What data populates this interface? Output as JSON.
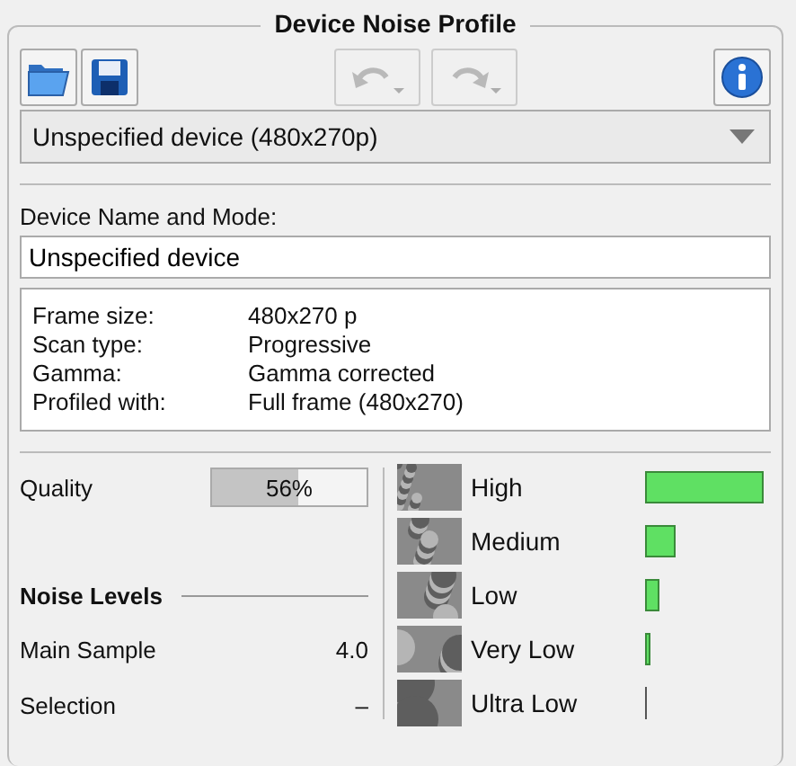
{
  "panel": {
    "title": "Device Noise Profile"
  },
  "toolbar": [
    {
      "kind": "open",
      "disabled": false
    },
    {
      "kind": "save",
      "disabled": false
    },
    {
      "kind": "undo",
      "disabled": true
    },
    {
      "kind": "redo",
      "disabled": true
    },
    {
      "kind": "info",
      "disabled": false
    }
  ],
  "device_dropdown": {
    "value": "Unspecified device (480x270p)"
  },
  "device_name": {
    "label": "Device Name and Mode:",
    "value": "Unspecified device"
  },
  "details": [
    {
      "label": "Frame size:",
      "value": "480x270 p"
    },
    {
      "label": "Scan type:",
      "value": "Progressive"
    },
    {
      "label": "Gamma:",
      "value": "Gamma corrected"
    },
    {
      "label": "Profiled with:",
      "value": "Full frame (480x270)"
    }
  ],
  "quality": {
    "label": "Quality",
    "reading": "56%",
    "level": 0.56
  },
  "noise_levels": {
    "title": "Noise Levels",
    "rows": [
      {
        "label": "Main Sample",
        "value": "4.0"
      },
      {
        "label": "Selection",
        "value": "–"
      }
    ]
  },
  "bands": [
    {
      "label": "High"
    },
    {
      "label": "Medium"
    },
    {
      "label": "Low"
    },
    {
      "label": "Very Low"
    },
    {
      "label": "Ultra Low"
    }
  ]
}
